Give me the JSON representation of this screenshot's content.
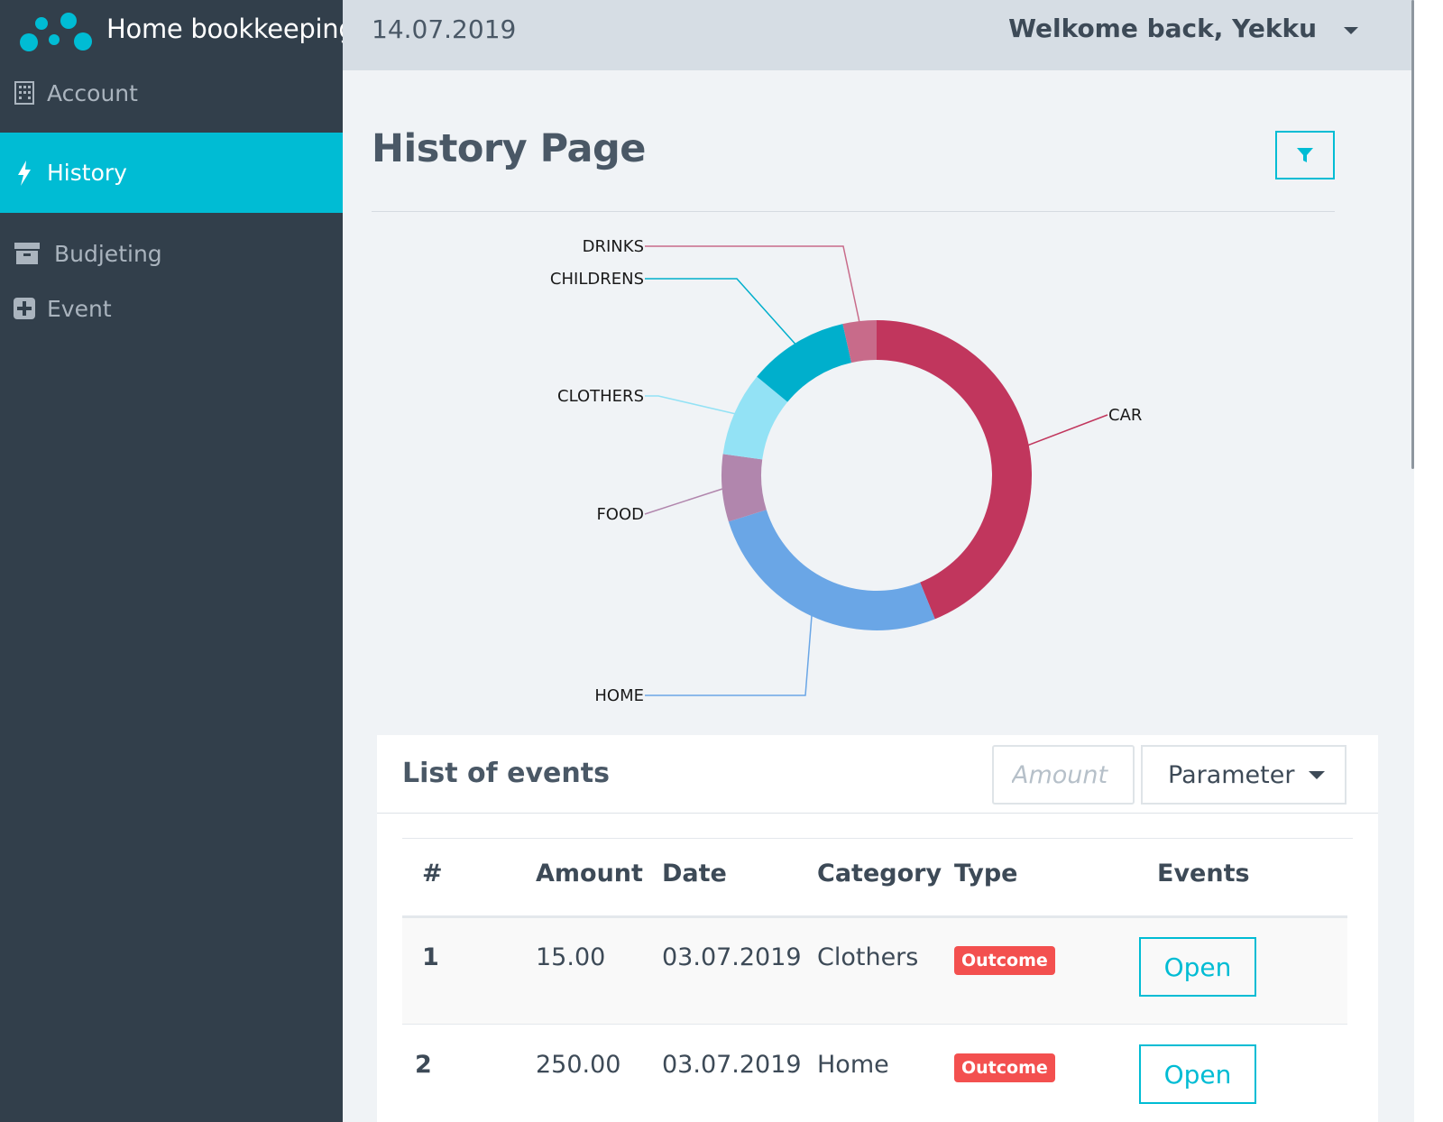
{
  "app": {
    "title": "Home bookkeeping"
  },
  "sidebar": {
    "items": [
      {
        "label": "Account",
        "icon": "building-icon",
        "active": false
      },
      {
        "label": "History",
        "icon": "bolt-icon",
        "active": true
      },
      {
        "label": "Budjeting",
        "icon": "archive-icon",
        "active": false
      },
      {
        "label": "Event",
        "icon": "plus-square-icon",
        "active": false
      }
    ]
  },
  "topbar": {
    "date": "14.07.2019",
    "greeting": "Welkome back, Yekku"
  },
  "page": {
    "title": "History Page",
    "filter_icon": "filter-icon"
  },
  "chart_data": {
    "type": "pie",
    "donut": true,
    "categories": [
      "CAR",
      "HOME",
      "FOOD",
      "CLOTHERS",
      "CHILDRENS",
      "DRINKS"
    ],
    "values": [
      250,
      150,
      40,
      50,
      60,
      20
    ],
    "colors": [
      "#c1365d",
      "#6aa6e6",
      "#b186ad",
      "#93e2f5",
      "#00afcc",
      "#c86b8a"
    ],
    "legend": "none"
  },
  "events": {
    "title": "List of events",
    "amount_placeholder": "Amount",
    "parameter_label": "Parameter",
    "columns": [
      "#",
      "Amount",
      "Date",
      "Category",
      "Type",
      "Events"
    ],
    "rows": [
      {
        "num": "1",
        "amount": "15.00",
        "date": "03.07.2019",
        "category": "Clothers",
        "type": "Outcome",
        "action": "Open"
      },
      {
        "num": "2",
        "amount": "250.00",
        "date": "03.07.2019",
        "category": "Home",
        "type": "Outcome",
        "action": "Open"
      }
    ]
  },
  "colors": {
    "accent": "#00bcd4",
    "sidebar_bg": "#323f4b",
    "outcome_badge": "#f3504f"
  }
}
